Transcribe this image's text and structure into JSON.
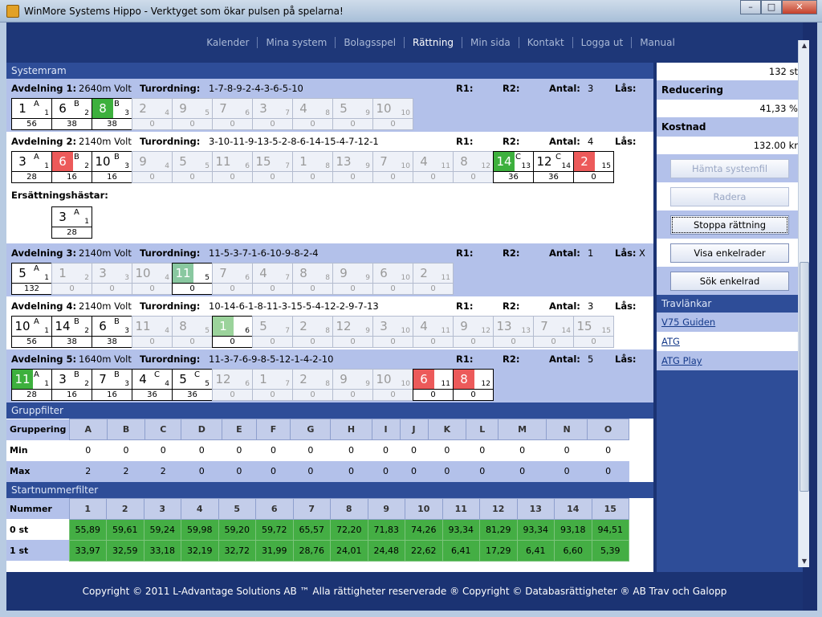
{
  "window": {
    "title": "WinMore Systems Hippo - Verktyget som ökar pulsen på spelarna!"
  },
  "nav": [
    "Kalender",
    "Mina system",
    "Bolagsspel",
    "Rättning",
    "Min sida",
    "Kontakt",
    "Logga ut",
    "Manual"
  ],
  "nav_active": "Rättning",
  "systemram": {
    "title": "Systemram",
    "labels": {
      "turordning": "Turordning:",
      "r1": "R1:",
      "r2": "R2:",
      "antal": "Antal:",
      "las": "Lås:"
    },
    "races": [
      {
        "name": "Avdelning 1:",
        "distance": "2640m Volt",
        "order": "1-7-8-9-2-4-3-6-5-10",
        "antal": "3",
        "las": "",
        "horses": [
          {
            "n": "1",
            "g": "A",
            "s": "1",
            "c": "56",
            "st": "sel"
          },
          {
            "n": "6",
            "g": "B",
            "s": "2",
            "c": "38",
            "st": "sel"
          },
          {
            "n": "8",
            "g": "B",
            "s": "3",
            "c": "38",
            "st": "g"
          },
          {
            "n": "2",
            "g": "",
            "s": "4",
            "c": "0",
            "st": "out"
          },
          {
            "n": "9",
            "g": "",
            "s": "5",
            "c": "0",
            "st": "out"
          },
          {
            "n": "7",
            "g": "",
            "s": "6",
            "c": "0",
            "st": "out"
          },
          {
            "n": "3",
            "g": "",
            "s": "7",
            "c": "0",
            "st": "out"
          },
          {
            "n": "4",
            "g": "",
            "s": "8",
            "c": "0",
            "st": "out"
          },
          {
            "n": "5",
            "g": "",
            "s": "9",
            "c": "0",
            "st": "out"
          },
          {
            "n": "10",
            "g": "",
            "s": "10",
            "c": "0",
            "st": "out"
          }
        ]
      },
      {
        "name": "Avdelning 2:",
        "distance": "2140m Volt",
        "order": "3-10-11-9-13-5-2-8-6-14-15-4-7-12-1",
        "antal": "4",
        "las": "",
        "horses": [
          {
            "n": "3",
            "g": "A",
            "s": "1",
            "c": "28",
            "st": "sel"
          },
          {
            "n": "6",
            "g": "B",
            "s": "2",
            "c": "16",
            "st": "r"
          },
          {
            "n": "10",
            "g": "B",
            "s": "3",
            "c": "16",
            "st": "sel"
          },
          {
            "n": "9",
            "g": "",
            "s": "4",
            "c": "0",
            "st": "out"
          },
          {
            "n": "5",
            "g": "",
            "s": "5",
            "c": "0",
            "st": "out"
          },
          {
            "n": "11",
            "g": "",
            "s": "6",
            "c": "0",
            "st": "out"
          },
          {
            "n": "15",
            "g": "",
            "s": "7",
            "c": "0",
            "st": "out"
          },
          {
            "n": "1",
            "g": "",
            "s": "8",
            "c": "0",
            "st": "out"
          },
          {
            "n": "13",
            "g": "",
            "s": "9",
            "c": "0",
            "st": "out"
          },
          {
            "n": "7",
            "g": "",
            "s": "10",
            "c": "0",
            "st": "out"
          },
          {
            "n": "4",
            "g": "",
            "s": "11",
            "c": "0",
            "st": "out"
          },
          {
            "n": "8",
            "g": "",
            "s": "12",
            "c": "0",
            "st": "out"
          },
          {
            "n": "14",
            "g": "C",
            "s": "13",
            "c": "36",
            "st": "g"
          },
          {
            "n": "12",
            "g": "C",
            "s": "14",
            "c": "36",
            "st": "sel"
          },
          {
            "n": "2",
            "g": "",
            "s": "15",
            "c": "0",
            "st": "r"
          }
        ]
      },
      {
        "name": "Avdelning 3:",
        "distance": "2140m Volt",
        "order": "11-5-3-7-1-6-10-9-8-2-4",
        "antal": "1",
        "las": "X",
        "horses": [
          {
            "n": "5",
            "g": "A",
            "s": "1",
            "c": "132",
            "st": "sel"
          },
          {
            "n": "1",
            "g": "",
            "s": "2",
            "c": "0",
            "st": "out"
          },
          {
            "n": "3",
            "g": "",
            "s": "3",
            "c": "0",
            "st": "out"
          },
          {
            "n": "10",
            "g": "",
            "s": "4",
            "c": "0",
            "st": "out"
          },
          {
            "n": "11",
            "g": "",
            "s": "5",
            "c": "0",
            "st": "tg"
          },
          {
            "n": "7",
            "g": "",
            "s": "6",
            "c": "0",
            "st": "out"
          },
          {
            "n": "4",
            "g": "",
            "s": "7",
            "c": "0",
            "st": "out"
          },
          {
            "n": "8",
            "g": "",
            "s": "8",
            "c": "0",
            "st": "out"
          },
          {
            "n": "9",
            "g": "",
            "s": "9",
            "c": "0",
            "st": "out"
          },
          {
            "n": "6",
            "g": "",
            "s": "10",
            "c": "0",
            "st": "out"
          },
          {
            "n": "2",
            "g": "",
            "s": "11",
            "c": "0",
            "st": "out"
          }
        ]
      },
      {
        "name": "Avdelning 4:",
        "distance": "2140m Volt",
        "order": "10-14-6-1-8-11-3-15-5-4-12-2-9-7-13",
        "antal": "3",
        "las": "",
        "horses": [
          {
            "n": "10",
            "g": "A",
            "s": "1",
            "c": "56",
            "st": "sel"
          },
          {
            "n": "14",
            "g": "B",
            "s": "2",
            "c": "38",
            "st": "sel"
          },
          {
            "n": "6",
            "g": "B",
            "s": "3",
            "c": "38",
            "st": "sel"
          },
          {
            "n": "11",
            "g": "",
            "s": "4",
            "c": "0",
            "st": "out"
          },
          {
            "n": "8",
            "g": "",
            "s": "5",
            "c": "0",
            "st": "out"
          },
          {
            "n": "1",
            "g": "",
            "s": "6",
            "c": "0",
            "st": "gp"
          },
          {
            "n": "5",
            "g": "",
            "s": "7",
            "c": "0",
            "st": "out"
          },
          {
            "n": "2",
            "g": "",
            "s": "8",
            "c": "0",
            "st": "out"
          },
          {
            "n": "12",
            "g": "",
            "s": "9",
            "c": "0",
            "st": "out"
          },
          {
            "n": "3",
            "g": "",
            "s": "10",
            "c": "0",
            "st": "out"
          },
          {
            "n": "4",
            "g": "",
            "s": "11",
            "c": "0",
            "st": "out"
          },
          {
            "n": "9",
            "g": "",
            "s": "12",
            "c": "0",
            "st": "out"
          },
          {
            "n": "13",
            "g": "",
            "s": "13",
            "c": "0",
            "st": "out"
          },
          {
            "n": "7",
            "g": "",
            "s": "14",
            "c": "0",
            "st": "out"
          },
          {
            "n": "15",
            "g": "",
            "s": "15",
            "c": "0",
            "st": "out"
          }
        ]
      },
      {
        "name": "Avdelning 5:",
        "distance": "1640m Volt",
        "order": "11-3-7-6-9-8-5-12-1-4-2-10",
        "antal": "5",
        "las": "",
        "horses": [
          {
            "n": "11",
            "g": "A",
            "s": "1",
            "c": "28",
            "st": "g"
          },
          {
            "n": "3",
            "g": "B",
            "s": "2",
            "c": "16",
            "st": "sel"
          },
          {
            "n": "7",
            "g": "B",
            "s": "3",
            "c": "16",
            "st": "sel"
          },
          {
            "n": "4",
            "g": "C",
            "s": "4",
            "c": "36",
            "st": "sel"
          },
          {
            "n": "5",
            "g": "C",
            "s": "5",
            "c": "36",
            "st": "sel"
          },
          {
            "n": "12",
            "g": "",
            "s": "6",
            "c": "0",
            "st": "out"
          },
          {
            "n": "1",
            "g": "",
            "s": "7",
            "c": "0",
            "st": "out"
          },
          {
            "n": "2",
            "g": "",
            "s": "8",
            "c": "0",
            "st": "out"
          },
          {
            "n": "9",
            "g": "",
            "s": "9",
            "c": "0",
            "st": "out"
          },
          {
            "n": "10",
            "g": "",
            "s": "10",
            "c": "0",
            "st": "out"
          },
          {
            "n": "6",
            "g": "",
            "s": "11",
            "c": "0",
            "st": "r"
          },
          {
            "n": "8",
            "g": "",
            "s": "12",
            "c": "0",
            "st": "r"
          }
        ]
      }
    ],
    "substitutes": {
      "label": "Ersättningshästar:",
      "horse": {
        "n": "3",
        "g": "A",
        "s": "1",
        "c": "28",
        "st": "sel"
      }
    }
  },
  "gruppfilter": {
    "title": "Gruppfilter",
    "row_labels": {
      "grp": "Gruppering",
      "min": "Min",
      "max": "Max"
    },
    "columns": [
      "A",
      "B",
      "C",
      "D",
      "E",
      "F",
      "G",
      "H",
      "I",
      "J",
      "K",
      "L",
      "M",
      "N",
      "O"
    ],
    "min": [
      "0",
      "0",
      "0",
      "0",
      "0",
      "0",
      "0",
      "0",
      "0",
      "0",
      "0",
      "0",
      "0",
      "0",
      "0"
    ],
    "max": [
      "2",
      "2",
      "2",
      "0",
      "0",
      "0",
      "0",
      "0",
      "0",
      "0",
      "0",
      "0",
      "0",
      "0",
      "0"
    ]
  },
  "startnummerfilter": {
    "title": "Startnummerfilter",
    "row_labels": {
      "num": "Nummer",
      "r0": "0 st",
      "r1": "1 st"
    },
    "columns": [
      "1",
      "2",
      "3",
      "4",
      "5",
      "6",
      "7",
      "8",
      "9",
      "10",
      "11",
      "12",
      "13",
      "14",
      "15"
    ],
    "r0": [
      "55,89",
      "59,61",
      "59,24",
      "59,98",
      "59,20",
      "59,72",
      "65,57",
      "72,20",
      "71,83",
      "74,26",
      "93,34",
      "81,29",
      "93,34",
      "93,18",
      "94,51"
    ],
    "r1": [
      "33,97",
      "32,59",
      "33,18",
      "32,19",
      "32,72",
      "31,99",
      "28,76",
      "24,01",
      "24,48",
      "22,62",
      "6,41",
      "17,29",
      "6,41",
      "6,60",
      "5,39"
    ]
  },
  "side": {
    "count": "132 st",
    "reducering_label": "Reducering",
    "reducering": "41,33 %",
    "kostnad_label": "Kostnad",
    "kostnad": "132.00 kr",
    "buttons": {
      "hamta": "Hämta systemfil",
      "radera": "Radera",
      "stoppa": "Stoppa rättning",
      "visa": "Visa enkelrader",
      "sok": "Sök enkelrad"
    },
    "links_title": "Travlänkar",
    "links": [
      "V75 Guiden",
      "ATG",
      "ATG Play"
    ]
  },
  "footer": "Copyright © 2011 L-Advantage Solutions AB ™ Alla rättigheter reserverade ® Copyright © Databasrättigheter ® AB Trav och Galopp",
  "colors": {
    "selected_green": "#3db03d",
    "scratched_red": "#ec5a5a",
    "band": "#b3c1ea",
    "header": "#2e4d98"
  }
}
